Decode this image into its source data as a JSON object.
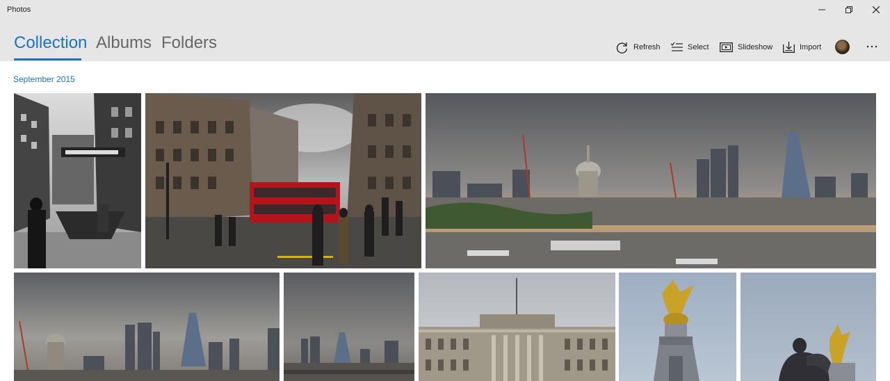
{
  "window": {
    "title": "Photos",
    "controls": [
      "minimize-icon",
      "restore-icon",
      "close-icon"
    ]
  },
  "nav": {
    "tabs": [
      {
        "label": "Collection",
        "active": true
      },
      {
        "label": "Albums",
        "active": false
      },
      {
        "label": "Folders",
        "active": false
      }
    ]
  },
  "commands": {
    "refresh": {
      "label": "Refresh",
      "icon": "refresh-icon"
    },
    "select": {
      "label": "Select",
      "icon": "select-list-icon"
    },
    "slideshow": {
      "label": "Slideshow",
      "icon": "slideshow-icon"
    },
    "import": {
      "label": "Import",
      "icon": "import-icon"
    },
    "account": {
      "icon": "avatar"
    },
    "more": {
      "icon": "more-icon"
    }
  },
  "collection": {
    "group_heading": "September 2015",
    "photos": [
      {
        "subject": "Black and white street scene with station sign"
      },
      {
        "subject": "Oxford Circus street with red double-decker bus"
      },
      {
        "subject": "London skyline with St Paul's Cathedral over Thames"
      },
      {
        "subject": "City skyline with Gherkin and St Paul's"
      },
      {
        "subject": "City skyline at dusk"
      },
      {
        "subject": "Buckingham Palace facade"
      },
      {
        "subject": "Golden statue atop Victoria Memorial"
      },
      {
        "subject": "Gilded statue with dark sculpture"
      }
    ]
  },
  "colors": {
    "accent": "#1a73c0",
    "chrome": "#e6e6e6"
  }
}
